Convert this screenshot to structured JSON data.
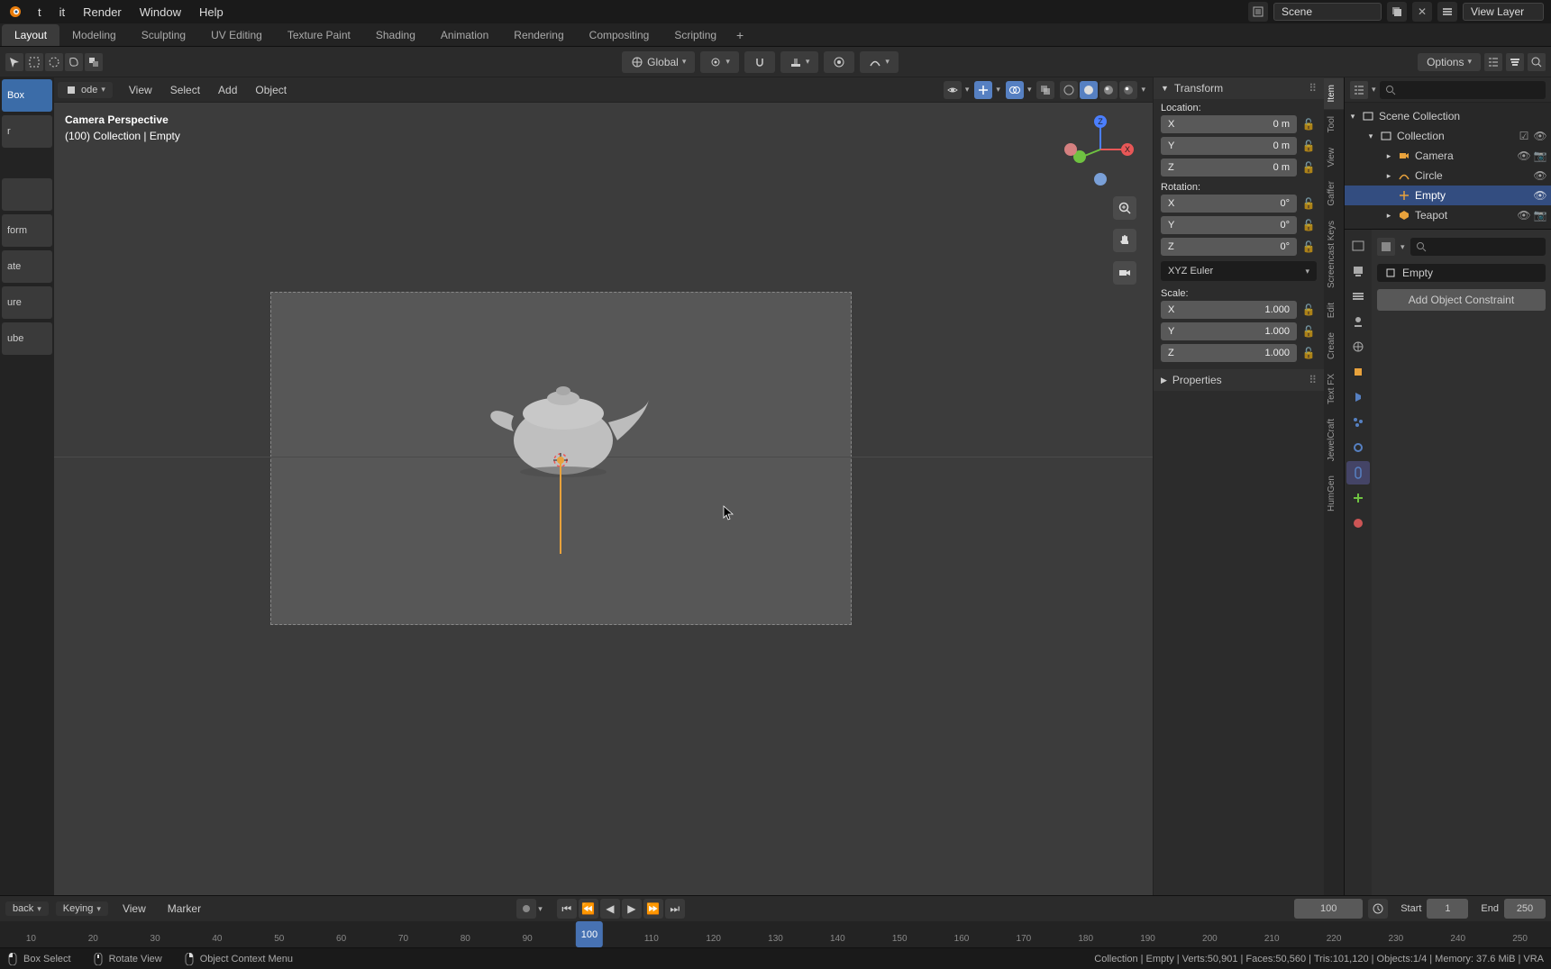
{
  "menu": {
    "file": "t",
    "edit": "it",
    "render": "Render",
    "window": "Window",
    "help": "Help"
  },
  "workspaces": {
    "layout": "Layout",
    "modeling": "Modeling",
    "sculpting": "Sculpting",
    "uv": "UV Editing",
    "texpaint": "Texture Paint",
    "shading": "Shading",
    "animation": "Animation",
    "rendering": "Rendering",
    "compositing": "Compositing",
    "scripting": "Scripting",
    "add": "+"
  },
  "scene": {
    "name": "Scene",
    "viewlayer": "View Layer"
  },
  "vh": {
    "orientation_global": "Global",
    "options": "Options"
  },
  "vp_menu": {
    "mode_suffix": "ode",
    "view": "View",
    "select": "Select",
    "add": "Add",
    "object": "Object"
  },
  "vp_text": {
    "line1": "Camera Perspective",
    "line2": "(100) Collection | Empty"
  },
  "tools": {
    "box": "Box",
    "cursor": "r",
    "transform": "form",
    "rotate": "ate",
    "texture": "ure",
    "cube": "ube"
  },
  "ntabs": {
    "item": "Item",
    "tool": "Tool",
    "view": "View",
    "gaffer": "Gaffer",
    "sckeys": "Screencast Keys",
    "edit": "Edit",
    "create": "Create",
    "textfx": "Text FX",
    "jewelcraft": "JewelCraft",
    "humgen": "HumGen"
  },
  "npanel": {
    "transform": "Transform",
    "properties": "Properties",
    "location": "Location:",
    "rotation": "Rotation:",
    "scale": "Scale:",
    "rot_mode": "XYZ Euler",
    "loc": {
      "x_label": "X",
      "x_val": "0 m",
      "y_label": "Y",
      "y_val": "0 m",
      "z_label": "Z",
      "z_val": "0 m"
    },
    "rot": {
      "x_label": "X",
      "x_val": "0°",
      "y_label": "Y",
      "y_val": "0°",
      "z_label": "Z",
      "z_val": "0°"
    },
    "scl": {
      "x_label": "X",
      "x_val": "1.000",
      "y_label": "Y",
      "y_val": "1.000",
      "z_label": "Z",
      "z_val": "1.000"
    }
  },
  "outliner": {
    "scene_collection": "Scene Collection",
    "collection": "Collection",
    "camera": "Camera",
    "circle": "Circle",
    "empty": "Empty",
    "teapot": "Teapot"
  },
  "props": {
    "object_name": "Empty",
    "add_constraint": "Add Object Constraint"
  },
  "timeline": {
    "back": "back",
    "keying": "Keying",
    "view": "View",
    "marker": "Marker",
    "frame_current": "100",
    "start_label": "Start",
    "start_val": "1",
    "end_label": "End",
    "end_val": "250",
    "marks": [
      "10",
      "20",
      "30",
      "40",
      "50",
      "60",
      "70",
      "80",
      "90",
      "100",
      "110",
      "120",
      "130",
      "140",
      "150",
      "160",
      "170",
      "180",
      "190",
      "200",
      "210",
      "220",
      "230",
      "240",
      "250"
    ],
    "playhead": "100"
  },
  "statusbar": {
    "box_select": "Box Select",
    "rotate_view": "Rotate View",
    "context_menu": "Object Context Menu",
    "right": "Collection | Empty | Verts:50,901 | Faces:50,560 | Tris:101,120 | Objects:1/4 | Memory: 37.6 MiB | VRA"
  },
  "axis": {
    "x": "X",
    "z": "Z"
  }
}
